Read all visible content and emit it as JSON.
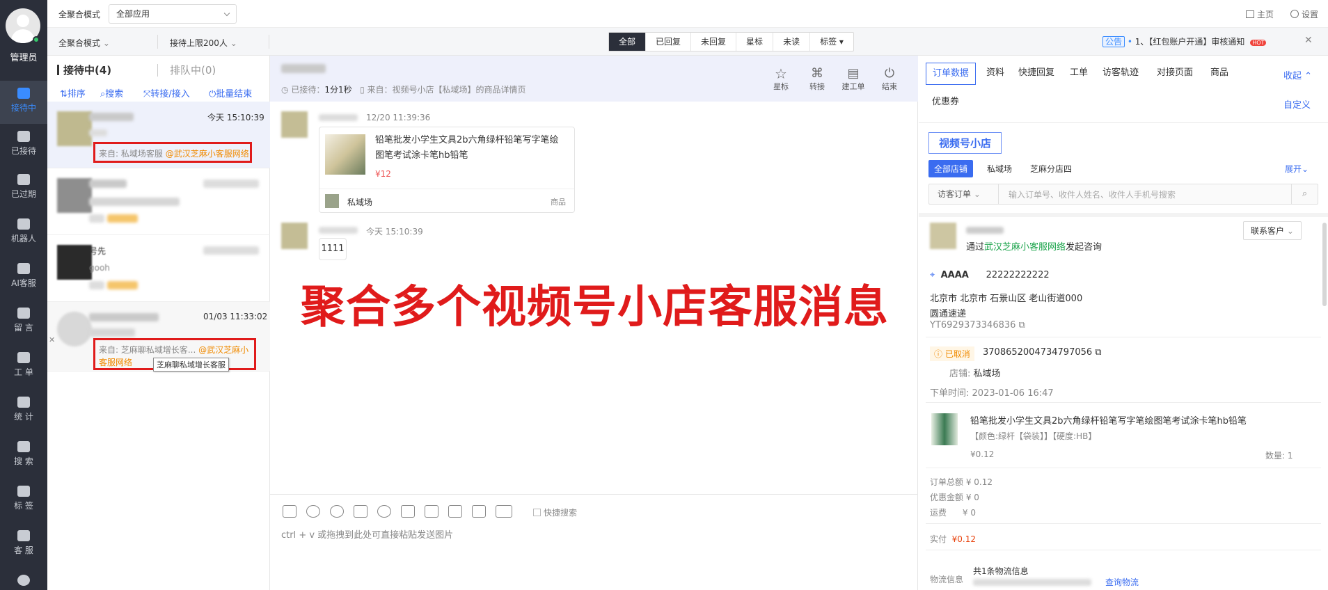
{
  "sidebar": {
    "role": "管理员",
    "items": [
      {
        "label": "接待中",
        "icon": "chat-bubble-icon"
      },
      {
        "label": "已接待",
        "icon": "check-circle-icon"
      },
      {
        "label": "已过期",
        "icon": "expired-chat-icon"
      },
      {
        "label": "机器人",
        "icon": "robot-icon"
      },
      {
        "label": "AI客服",
        "icon": "ai-chat-icon"
      },
      {
        "label": "留 言",
        "icon": "message-note-icon"
      },
      {
        "label": "工 单",
        "icon": "ticket-icon"
      },
      {
        "label": "统 计",
        "icon": "stats-icon"
      },
      {
        "label": "搜 索",
        "icon": "search-icon"
      },
      {
        "label": "标 签",
        "icon": "tag-icon"
      },
      {
        "label": "客 服",
        "icon": "agent-icon"
      }
    ]
  },
  "topbar": {
    "mode_label": "全聚合模式",
    "app_select": "全部应用",
    "home": "主页",
    "settings": "设置"
  },
  "subbar": {
    "mode_select": "全聚合模式",
    "limit_select": "接待上限200人",
    "filters": [
      "全部",
      "已回复",
      "未回复",
      "星标",
      "未读",
      "标签 ▾"
    ],
    "notice_badge": "公告",
    "notice_text": "1、【红包账户开通】审核通知",
    "hot": "HOT"
  },
  "convlist": {
    "tab_active": "接待中(4)",
    "tab_queue": "排队中(0)",
    "actions": [
      "排序",
      "搜索",
      "转接/接入",
      "批量结束"
    ],
    "items": [
      {
        "time": "今天 15:10:39",
        "source_prefix": "来自: 私域场客服",
        "source_at": "@武汉芝麻小客服网络"
      },
      {
        "time": "",
        "tag": ""
      },
      {
        "name": "号先",
        "preview": "gooh"
      },
      {
        "time": "01/03 11:33:02",
        "source_prefix": "来自: 芝麻聊私域增长客...",
        "source_at": "@武汉芝麻小客服网络",
        "tooltip": "芝麻聊私域增长客服"
      }
    ]
  },
  "chat": {
    "wait_label": "已接待：",
    "wait_value": "1分1秒",
    "from_text": "来自：视频号小店【私域场】的商品详情页",
    "header_buttons": [
      "星标",
      "转接",
      "建工单",
      "结束"
    ],
    "msg1_time": "12/20 11:39:36",
    "product_title": "铅笔批发小学生文具2b六角绿杆铅笔写字笔绘图笔考试涂卡笔hb铅笔",
    "product_price": "¥12",
    "shop_name": "私域场",
    "card_type": "商品",
    "msg2_time": "今天 15:10:39",
    "msg2_text": "1111",
    "overlay": "聚合多个视频号小店客服消息",
    "quick_search": "快捷搜索",
    "input_placeholder": "ctrl + v 或拖拽到此处可直接粘贴发送图片"
  },
  "rpanel": {
    "tabs": [
      "订单数据",
      "资料",
      "快捷回复",
      "工单",
      "访客轨迹",
      "对接页面",
      "商品"
    ],
    "tab2": "优惠券",
    "collapse": "收起",
    "customize": "自定义",
    "store_title": "视频号小店",
    "store_filters": [
      "全部店铺",
      "私域场",
      "芝麻分店四"
    ],
    "expand": "展开",
    "order_select": "访客订单",
    "search_placeholder": "输入订单号、收件人姓名、收件人手机号搜索",
    "contact_btn": "联系客户",
    "via_prefix": "通过",
    "via_link": "武汉芝麻小客服网络",
    "via_suffix": "发起咨询",
    "recipient": "AAAA",
    "phone": "22222222222",
    "address": "北京市 北京市 石景山区 老山街道000",
    "courier": "圆通速递",
    "tracking": "YT6929373346836",
    "order_status": "已取消",
    "order_no": "3708652004734797056",
    "shop_label": "店铺:",
    "shop_value": "私域场",
    "order_time_label": "下单时间:",
    "order_time": "2023-01-06 16:47",
    "item_title": "铅笔批发小学生文具2b六角绿杆铅笔写字笔绘图笔考试涂卡笔hb铅笔",
    "item_spec": "【颜色:绿杆【袋装】】【硬度:HB】",
    "item_price": "¥0.12",
    "item_qty": "数量: 1",
    "total": "订单总额 ¥ 0.12",
    "discount": "优惠金额 ¥ 0",
    "freight": "运费      ¥ 0",
    "paid_label": "实付",
    "paid_value": "¥0.12",
    "logistics_label": "物流信息",
    "logistics_text": "共1条物流信息",
    "logistics_link": "查询物流"
  },
  "colors": {
    "rail": "#2b2f3a",
    "accent": "#3a6cf0",
    "red_overlay": "#e01b1b",
    "orange": "#f08a00"
  }
}
